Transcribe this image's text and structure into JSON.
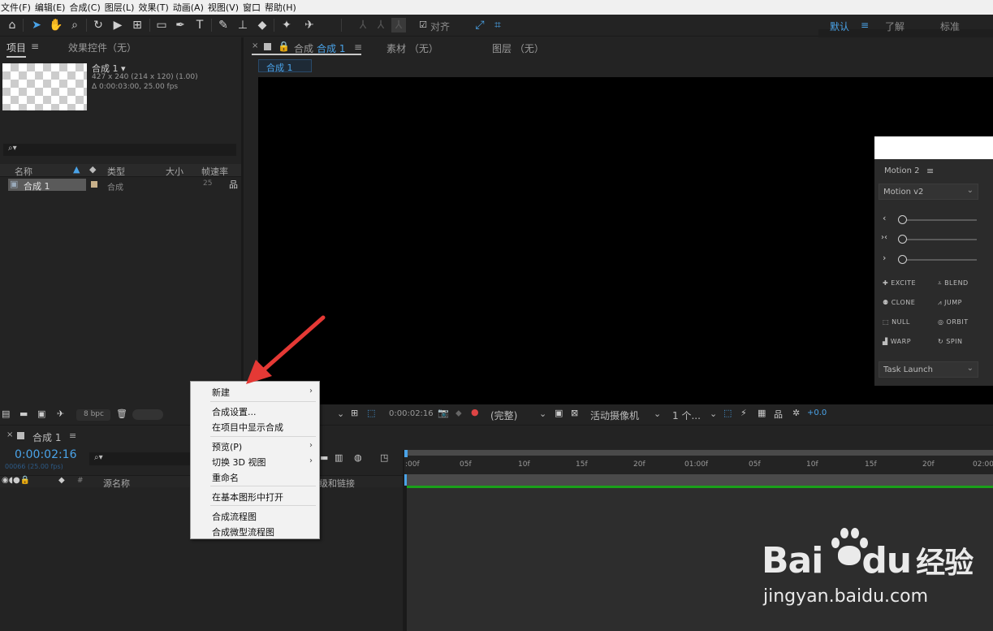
{
  "menubar": [
    "文件(F)",
    "编辑(E)",
    "合成(C)",
    "图层(L)",
    "效果(T)",
    "动画(A)",
    "视图(V)",
    "窗口",
    "帮助(H)"
  ],
  "toolbar": {
    "align_label": "对齐",
    "workspaces": [
      "默认",
      "了解",
      "标准"
    ]
  },
  "project": {
    "tab_project": "项目",
    "tab_effects": "效果控件（无）",
    "comp_name": "合成 1",
    "comp_res": "427 x 240  (214 x 120) (1.00)",
    "comp_duration": "Δ 0:00:03:00, 25.00 fps",
    "search_placeholder": "",
    "columns": [
      "名称",
      "类型",
      "大小",
      "帧速率"
    ],
    "items": [
      {
        "name": "合成 1",
        "type": "合成",
        "fps": "25"
      }
    ],
    "bpc": "8 bpc"
  },
  "viewer": {
    "tab_prefix": "合成",
    "tab_comp": "合成 1",
    "tab_footage": "素材 （无）",
    "tab_layer": "图层 （无）",
    "subtab": "合成 1"
  },
  "motion": {
    "title": "Motion 2",
    "dropdown": "Motion v2",
    "buttons": [
      "EXCITE",
      "BLEND",
      "CLONE",
      "JUMP",
      "NULL",
      "ORBIT",
      "WARP",
      "SPIN"
    ],
    "task": "Task Launch"
  },
  "viewer_controls": {
    "timecode": "0:00:02:16",
    "quality": "(完整)",
    "camera": "活动摄像机",
    "views": "1 个...",
    "exposure": "+0.0"
  },
  "timeline": {
    "tab": "合成 1",
    "timecode": "0:00:02:16",
    "frame_info": "00066 (25.00 fps)",
    "col_source": "源名称",
    "col_parent": "级和链接",
    "ticks": [
      ":00f",
      "05f",
      "10f",
      "15f",
      "20f",
      "01:00f",
      "05f",
      "10f",
      "15f",
      "20f",
      "02:00"
    ]
  },
  "context_menu": {
    "items": [
      "新建",
      "合成设置...",
      "在项目中显示合成",
      "预览(P)",
      "切换 3D 视图",
      "重命名",
      "在基本图形中打开",
      "合成流程图",
      "合成微型流程图"
    ]
  },
  "watermark": {
    "brand": "Bai",
    "brand2": "du",
    "brand_cn": "经验",
    "url": "jingyan.baidu.com"
  },
  "colors": {
    "accent": "#4aa3e8",
    "arrow": "#e53935",
    "timeline_green": "#1aa01a"
  }
}
